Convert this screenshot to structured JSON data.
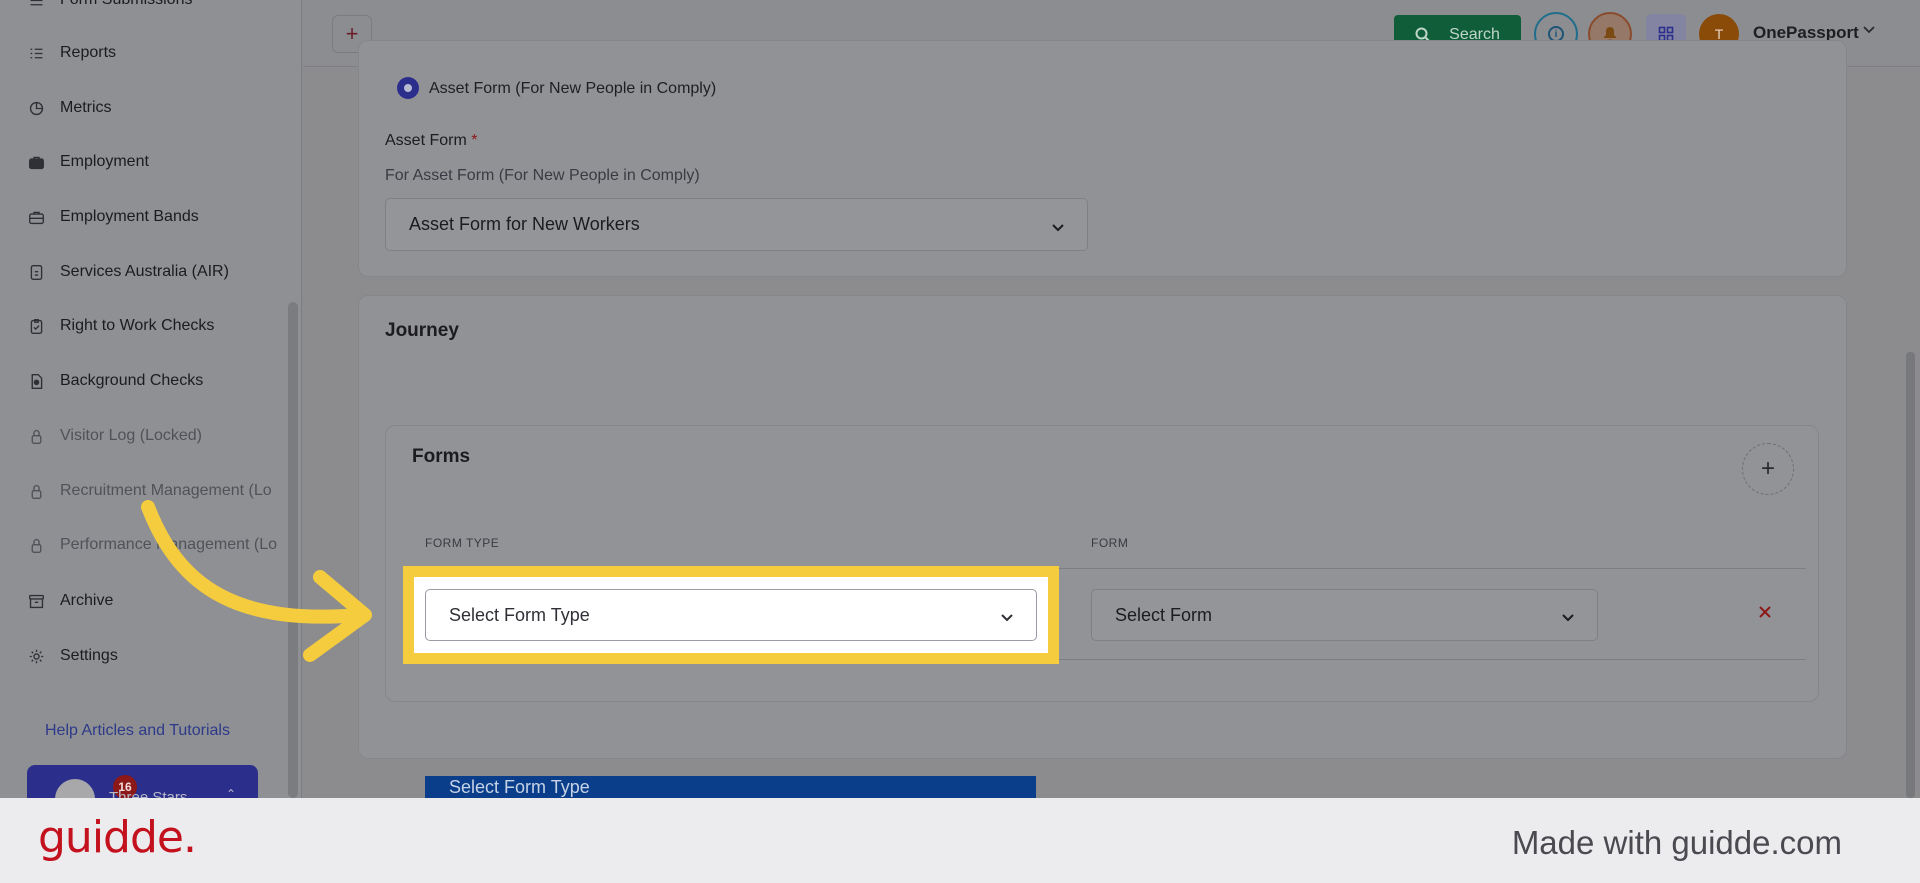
{
  "sidebar": {
    "items": [
      {
        "label": "Form Submissions",
        "icon": "list-icon",
        "locked": false
      },
      {
        "label": "Reports",
        "icon": "list-icon",
        "locked": false
      },
      {
        "label": "Metrics",
        "icon": "pie-chart-icon",
        "locked": false
      },
      {
        "label": "Employment",
        "icon": "briefcase-icon",
        "locked": false
      },
      {
        "label": "Employment Bands",
        "icon": "briefcase-outline-icon",
        "locked": false
      },
      {
        "label": "Services Australia (AIR)",
        "icon": "document-icon",
        "locked": false
      },
      {
        "label": "Right to Work Checks",
        "icon": "clipboard-icon",
        "locked": false
      },
      {
        "label": "Background Checks",
        "icon": "file-check-icon",
        "locked": false
      },
      {
        "label": "Visitor Log (Locked)",
        "icon": "lock-icon",
        "locked": true
      },
      {
        "label": "Recruitment Management (Lo",
        "icon": "lock-icon",
        "locked": true
      },
      {
        "label": "Performance Management (Lo",
        "icon": "lock-icon",
        "locked": true
      },
      {
        "label": "Archive",
        "icon": "archive-icon",
        "locked": false
      },
      {
        "label": "Settings",
        "icon": "gear-icon",
        "locked": false
      }
    ],
    "help_link": "Help Articles and Tutorials",
    "org": {
      "name": "Three Stars",
      "badge_count": "16"
    }
  },
  "topbar": {
    "add_label": "+",
    "search_label": "Search",
    "avatar_initial": "T",
    "user_name": "OnePassport"
  },
  "form": {
    "radio_label": "Asset Form (For New People in Comply)",
    "asset_form_title": "Asset Form",
    "required_marker": "*",
    "asset_form_help": "For Asset Form (For New People in Comply)",
    "asset_form_value": "Asset Form for New Workers"
  },
  "journey": {
    "title": "Journey",
    "forms_title": "Forms",
    "col_form_type": "FORM TYPE",
    "col_form": "FORM",
    "row": {
      "form_type_placeholder": "Select Form Type",
      "form_placeholder": "Select Form"
    },
    "dropdown_peek": "Select Form Type"
  },
  "footer": {
    "brand": "guidde.",
    "made_with": "Made with guidde.com"
  },
  "colors": {
    "highlight": "#f5cc3e",
    "arrow": "#f5cc3e",
    "brand": "#c3121e",
    "search_button": "#0f5e39",
    "remove": "#8c1818"
  }
}
